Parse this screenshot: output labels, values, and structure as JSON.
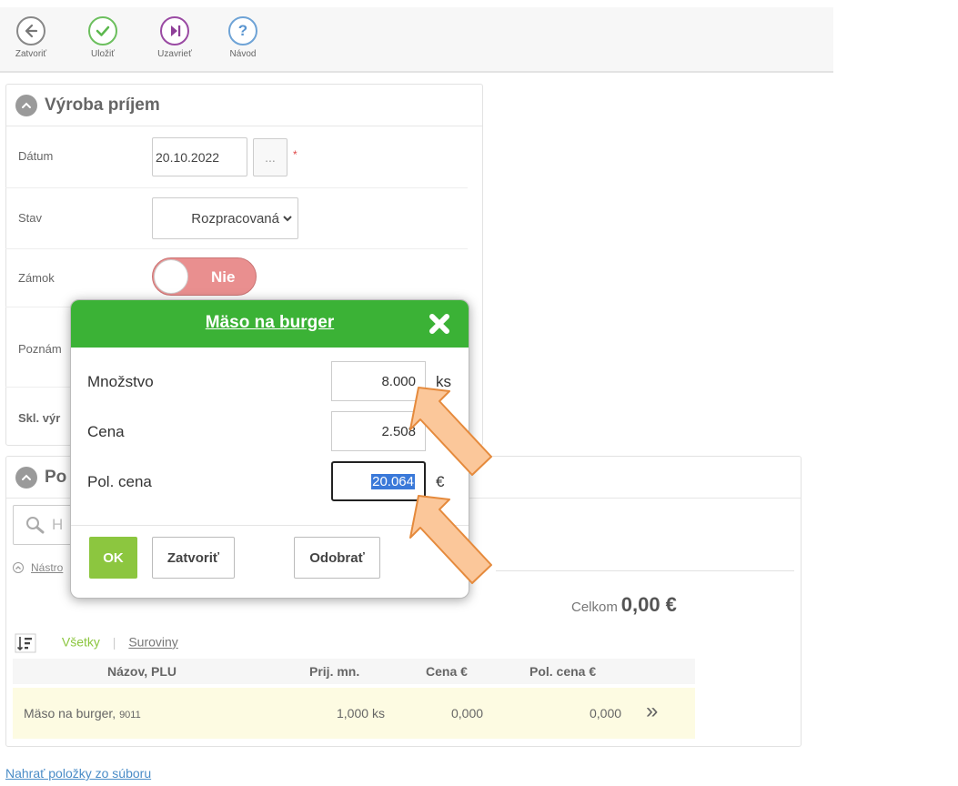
{
  "toolbar": {
    "close_label": "Zatvoriť",
    "save_label": "Uložiť",
    "finish_label": "Uzavrieť",
    "help_label": "Návod",
    "help_glyph": "?"
  },
  "form": {
    "title": "Výroba príjem",
    "date_label": "Dátum",
    "date_value": "20.10.2022",
    "date_picker_glyph": "...",
    "required_mark": "*",
    "state_label": "Stav",
    "state_value": "Rozpracovaná",
    "lock_label": "Zámok",
    "lock_value": "Nie",
    "note_label_visible": "Poznám",
    "warehouse_label_visible": "Skl. výr"
  },
  "items": {
    "title_visible": "Po",
    "search_placeholder_visible": "H",
    "tools_link_visible": "Nástro",
    "total_label": "Celkom",
    "total_value": "0,00 €",
    "filter_all": "Všetky",
    "filter_separator": "|",
    "filter_raw": "Suroviny",
    "columns": [
      "Názov, PLU",
      "Prij. mn.",
      "Cena €",
      "Pol. cena €"
    ],
    "rows": [
      {
        "name": "Mäso na burger, ",
        "plu": "9011",
        "qty": "1,000",
        "unit": "ks",
        "price": "0,000",
        "total": "0,000",
        "more": "»"
      }
    ]
  },
  "upload_link": "Nahrať položky zo súboru",
  "modal": {
    "title": "Mäso na burger",
    "qty_label": "Množstvo",
    "qty_value": "8.000",
    "qty_unit": "ks",
    "price_label": "Cena",
    "price_value": "2.508",
    "line_price_label": "Pol. cena",
    "line_price_value": "20.064",
    "currency": "€",
    "ok_label": "OK",
    "close_label": "Zatvoriť",
    "remove_label": "Odobrať"
  },
  "colors": {
    "header_green": "#3bb236",
    "ok_green": "#8cc63f",
    "toggle_red": "#e98f8f",
    "row_yellow": "#fdfbe2",
    "arrow_orange": "#fbc79a",
    "link_blue": "#4a8cc7"
  }
}
